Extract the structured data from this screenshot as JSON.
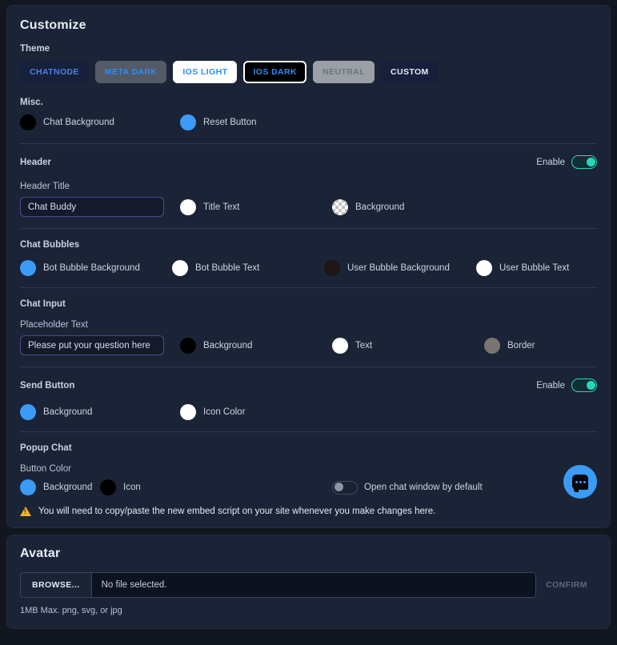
{
  "customize": {
    "title": "Customize",
    "theme": {
      "label": "Theme",
      "options": [
        {
          "id": "chatnode",
          "label": "CHATNODE",
          "selected": false
        },
        {
          "id": "meta-dark",
          "label": "META DARK",
          "selected": false
        },
        {
          "id": "ios-light",
          "label": "IOS LIGHT",
          "selected": false
        },
        {
          "id": "ios-dark",
          "label": "IOS DARK",
          "selected": true
        },
        {
          "id": "neutral",
          "label": "NEUTRAL",
          "selected": false
        },
        {
          "id": "custom",
          "label": "CUSTOM",
          "selected": false
        }
      ]
    },
    "misc": {
      "label": "Misc.",
      "swatches": [
        {
          "label": "Chat Background",
          "color": "#000000"
        },
        {
          "label": "Reset Button",
          "color": "#3b9bf5"
        }
      ]
    },
    "header": {
      "label": "Header",
      "enable_label": "Enable",
      "enabled": true,
      "title_field_label": "Header Title",
      "title_value": "Chat Buddy",
      "swatches": [
        {
          "label": "Title Text",
          "color": "#ffffff"
        },
        {
          "label": "Background",
          "color": "transparent"
        }
      ]
    },
    "chat_bubbles": {
      "label": "Chat Bubbles",
      "swatches": [
        {
          "label": "Bot Bubble Background",
          "color": "#3b9bf5"
        },
        {
          "label": "Bot Bubble Text",
          "color": "#ffffff"
        },
        {
          "label": "User Bubble Background",
          "color": "#1f1512"
        },
        {
          "label": "User Bubble Text",
          "color": "#ffffff"
        }
      ]
    },
    "chat_input": {
      "label": "Chat Input",
      "placeholder_field_label": "Placeholder Text",
      "placeholder_value": "Please put your question here",
      "swatches": [
        {
          "label": "Background",
          "color": "#000000"
        },
        {
          "label": "Text",
          "color": "#ffffff"
        },
        {
          "label": "Border",
          "color": "#7a7470"
        }
      ]
    },
    "send_button": {
      "label": "Send Button",
      "enable_label": "Enable",
      "enabled": true,
      "swatches": [
        {
          "label": "Background",
          "color": "#3b9bf5"
        },
        {
          "label": "Icon Color",
          "color": "#ffffff"
        }
      ]
    },
    "popup_chat": {
      "label": "Popup Chat",
      "button_color_label": "Button Color",
      "swatches": [
        {
          "label": "Background",
          "color": "#3b9bf5"
        },
        {
          "label": "Icon",
          "color": "#000000"
        }
      ],
      "open_default_label": "Open chat window by default",
      "open_default_enabled": false
    },
    "warning": "You will need to copy/paste the new embed script on your site whenever you make changes here."
  },
  "avatar": {
    "title": "Avatar",
    "browse_label": "BROWSE...",
    "file_name": "No file selected.",
    "confirm_label": "CONFIRM",
    "hint": "1MB Max. png, svg, or jpg"
  }
}
